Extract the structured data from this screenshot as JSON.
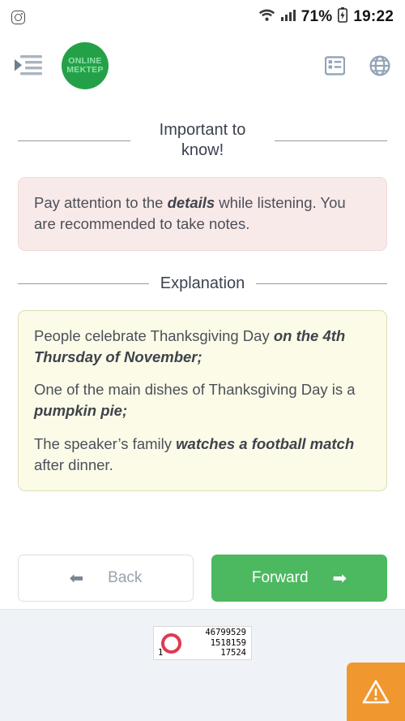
{
  "status_bar": {
    "app_icon": "instagram-icon",
    "wifi_icon": "wifi-icon",
    "signal_icon": "signal-bars-icon",
    "battery_percent": "71%",
    "battery_icon": "battery-icon",
    "time": "19:22"
  },
  "app_bar": {
    "menu_icon": "indent-menu-icon",
    "logo_line1": "ONLINE",
    "logo_line2": "MEKTEP",
    "list_icon": "list-view-icon",
    "globe_icon": "globe-icon",
    "logo_color": "#24a148"
  },
  "sections": {
    "important": {
      "title": "Important to know!",
      "body_prefix": "Pay attention to the ",
      "body_bold": "details",
      "body_suffix": " while listening. You are recommended to take notes.",
      "bg_color": "#f9eaea"
    },
    "explanation": {
      "title": "Explanation",
      "bg_color": "#fbfbe8",
      "items": [
        {
          "plain_1": "People celebrate Thanksgiving Day ",
          "bold_1": "on the 4",
          "plain_2": "",
          "bold_2": "th Thursday of November;",
          "plain_3": ""
        },
        {
          "plain_1": "One of the main dishes of Thanksgiving Day is a ",
          "bold_1": "pumpkin pie;",
          "plain_2": "",
          "bold_2": "",
          "plain_3": ""
        },
        {
          "plain_1": "The speaker’s family ",
          "bold_1": "watches a football match",
          "plain_2": " after dinner.",
          "bold_2": "",
          "plain_3": ""
        }
      ]
    }
  },
  "nav": {
    "back_label": "Back",
    "back_arrow": "⬅",
    "forward_label": "Forward",
    "forward_arrow": "➡",
    "forward_color": "#4cb860"
  },
  "footer": {
    "counter": {
      "ring_icon": "red-ring-icon",
      "line1": "46799529",
      "line2": "1518159",
      "line3": "17524",
      "index": "1"
    },
    "warning_icon": "warning-triangle-icon",
    "warning_color": "#f0982f"
  }
}
